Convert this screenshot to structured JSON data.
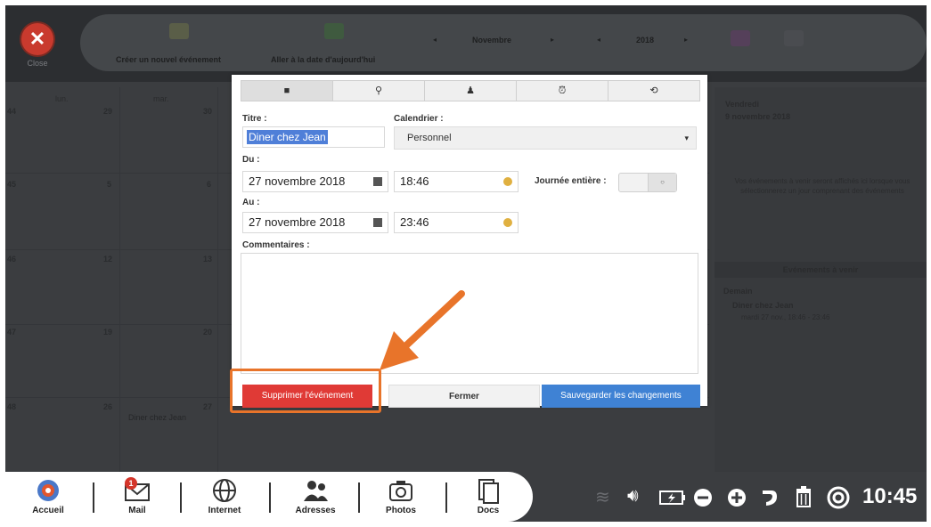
{
  "toolbar": {
    "close_label": "Close",
    "create_event": "Créer un nouvel événement",
    "goto_today": "Aller à la date d'aujourd'hui",
    "month": "Novembre",
    "year": "2018",
    "prev_arrow": "◂",
    "next_arrow": "▸"
  },
  "calendar": {
    "col_heads": [
      "lun.",
      "mar."
    ],
    "weeks": [
      "44",
      "45",
      "46",
      "47",
      "48"
    ],
    "days_col1": [
      "29",
      "5",
      "12",
      "19",
      "26"
    ],
    "days_col2": [
      "30",
      "6",
      "13",
      "20",
      "27"
    ],
    "grid_event": "Diner chez Jean"
  },
  "right_panel": {
    "day_name": "Vendredi",
    "day_date": "9 novembre 2018",
    "message": "Vos événements à venir seront affichés ici lorsque vous sélectionnerez un jour comprenant des événements",
    "upcoming_header": "Evénements à venir",
    "tomorrow": "Demain",
    "event_title": "Diner chez Jean",
    "event_time": "mardi 27 nov., 18:46 - 23:46"
  },
  "dialog": {
    "title_label": "Titre :",
    "title_value": "Diner chez Jean",
    "calendar_label": "Calendrier :",
    "calendar_value": "Personnel",
    "from_label": "Du :",
    "from_date": "27 novembre 2018",
    "from_time": "18:46",
    "allday_label": "Journée entière :",
    "to_label": "Au :",
    "to_date": "27 novembre 2018",
    "to_time": "23:46",
    "comments_label": "Commentaires :",
    "delete_button": "Supprimer l'événement",
    "close_button": "Fermer",
    "save_button": "Sauvegarder les changements"
  },
  "dock": {
    "items": [
      "Accueil",
      "Mail",
      "Internet",
      "Adresses",
      "Photos",
      "Docs"
    ],
    "mail_badge": "1",
    "clock": "10:45"
  },
  "colors": {
    "accent_red": "#e03a36",
    "accent_blue": "#3f82d4",
    "highlight_orange": "#e8742a"
  }
}
